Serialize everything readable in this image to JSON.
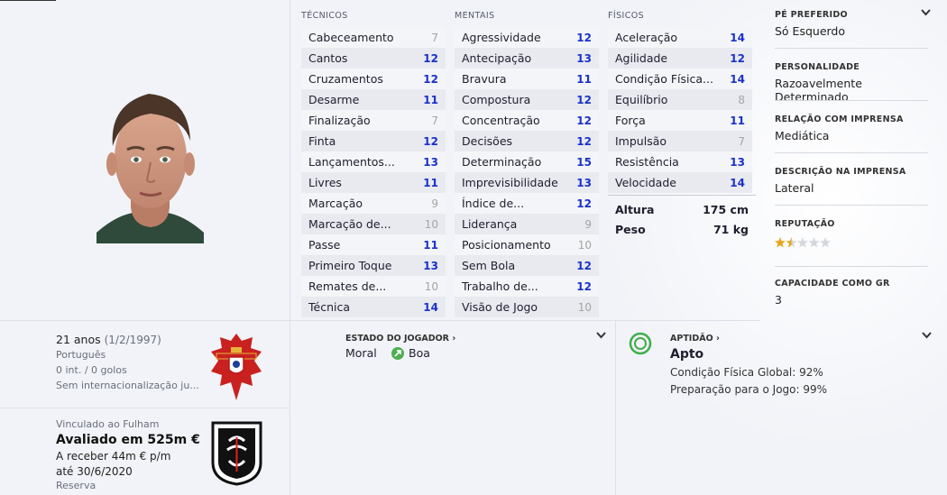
{
  "attributes": {
    "tecnicos": {
      "header": "TÉCNICOS",
      "items": [
        {
          "label": "Cabeceamento",
          "value": "7",
          "low": true
        },
        {
          "label": "Cantos",
          "value": "12",
          "low": false
        },
        {
          "label": "Cruzamentos",
          "value": "12",
          "low": false
        },
        {
          "label": "Desarme",
          "value": "11",
          "low": false
        },
        {
          "label": "Finalização",
          "value": "7",
          "low": true
        },
        {
          "label": "Finta",
          "value": "12",
          "low": false
        },
        {
          "label": "Lançamentos...",
          "value": "13",
          "low": false
        },
        {
          "label": "Livres",
          "value": "11",
          "low": false
        },
        {
          "label": "Marcação",
          "value": "9",
          "low": true
        },
        {
          "label": "Marcação de...",
          "value": "10",
          "low": true
        },
        {
          "label": "Passe",
          "value": "11",
          "low": false
        },
        {
          "label": "Primeiro Toque",
          "value": "13",
          "low": false
        },
        {
          "label": "Remates de...",
          "value": "10",
          "low": true
        },
        {
          "label": "Técnica",
          "value": "14",
          "low": false
        }
      ]
    },
    "mentais": {
      "header": "MENTAIS",
      "items": [
        {
          "label": "Agressividade",
          "value": "12",
          "low": false
        },
        {
          "label": "Antecipação",
          "value": "13",
          "low": false
        },
        {
          "label": "Bravura",
          "value": "11",
          "low": false
        },
        {
          "label": "Compostura",
          "value": "12",
          "low": false
        },
        {
          "label": "Concentração",
          "value": "12",
          "low": false
        },
        {
          "label": "Decisões",
          "value": "12",
          "low": false
        },
        {
          "label": "Determinação",
          "value": "15",
          "low": false
        },
        {
          "label": "Imprevisibilidade",
          "value": "13",
          "low": false
        },
        {
          "label": "Índice de...",
          "value": "12",
          "low": false
        },
        {
          "label": "Liderança",
          "value": "9",
          "low": true
        },
        {
          "label": "Posicionamento",
          "value": "10",
          "low": true
        },
        {
          "label": "Sem Bola",
          "value": "12",
          "low": false
        },
        {
          "label": "Trabalho de...",
          "value": "12",
          "low": false
        },
        {
          "label": "Visão de Jogo",
          "value": "10",
          "low": true
        }
      ]
    },
    "fisicos": {
      "header": "FÍSICOS",
      "items": [
        {
          "label": "Aceleração",
          "value": "14",
          "low": false
        },
        {
          "label": "Agilidade",
          "value": "12",
          "low": false
        },
        {
          "label": "Condição Física...",
          "value": "14",
          "low": false
        },
        {
          "label": "Equilíbrio",
          "value": "8",
          "low": true
        },
        {
          "label": "Força",
          "value": "11",
          "low": false
        },
        {
          "label": "Impulsão",
          "value": "7",
          "low": true
        },
        {
          "label": "Resistência",
          "value": "13",
          "low": false
        },
        {
          "label": "Velocidade",
          "value": "14",
          "low": false
        }
      ]
    },
    "measures": {
      "altura_label": "Altura",
      "altura_value": "175 cm",
      "peso_label": "Peso",
      "peso_value": "71 kg"
    }
  },
  "sidebar": {
    "pe_header": "PÉ PREFERIDO",
    "pe_value": "Só Esquerdo",
    "pers_header": "PERSONALIDADE",
    "pers_value": "Razoavelmente Determinado",
    "imprensa_header": "RELAÇÃO COM IMPRENSA",
    "imprensa_value": "Mediática",
    "desc_header": "DESCRIÇÃO NA IMPRENSA",
    "desc_value": "Lateral",
    "rep_header": "REPUTAÇÃO",
    "rep_stars": 1.5,
    "gr_header": "CAPACIDADE COMO GR",
    "gr_value": "3"
  },
  "bio": {
    "age": "21 anos",
    "dob": "(1/2/1997)",
    "nationality": "Português",
    "caps": "0 int. / 0 golos",
    "intl": "Sem internacionalização ju..."
  },
  "contract": {
    "club": "Vinculado ao Fulham",
    "value": "Avaliado em 525m €",
    "wage": "A receber 44m € p/m",
    "until": "até 30/6/2020",
    "role": "Reserva"
  },
  "state": {
    "header": "ESTADO DO JOGADOR",
    "moral_label": "Moral",
    "moral_value": "Boa"
  },
  "fitness": {
    "header": "APTIDÃO",
    "status": "Apto",
    "global": "Condição Física Global: 92%",
    "prep": "Preparação para o Jogo: 99%"
  },
  "colors": {
    "accent": "#1a32c8",
    "low": "#a4a4a4",
    "moral": "#4caf50",
    "fit_ring": "#3fae49"
  }
}
